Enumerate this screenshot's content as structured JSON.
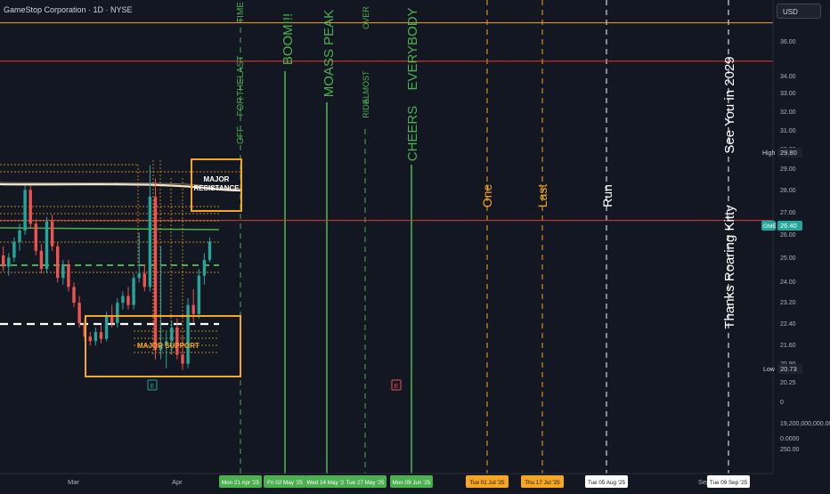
{
  "header": {
    "symbol_title": "GameStop Corporation · 1D · NYSE",
    "currency": "USD"
  },
  "colors": {
    "background": "#131722",
    "up": "#26a69a",
    "down": "#ef5350",
    "orange": "#f5a623",
    "green": "#4caf50",
    "red": "#e53935",
    "white": "#ffffff"
  },
  "price_axis": {
    "ticks": [
      "36.00",
      "34.00",
      "33.00",
      "32.00",
      "31.00",
      "30.00",
      "29.00",
      "28.00",
      "27.00",
      "26.00",
      "25.00",
      "24.00",
      "23.20",
      "22.40",
      "21.60",
      "20.90",
      "20.25",
      "0",
      "19,200,000,000.00",
      "0.0000",
      "250.00"
    ],
    "high_label": "High",
    "high_value": "29.80",
    "ticker_label": "GME",
    "ticker_value": "26.40",
    "low_label": "Low",
    "low_value": "20.73"
  },
  "time_axis": {
    "month_labels": [
      "Mar",
      "Apr",
      "Sep"
    ],
    "date_labels": [
      {
        "text": "Mon 21 Apr '25",
        "style": "green"
      },
      {
        "text": "Fri 02 May '25",
        "style": "green"
      },
      {
        "text": "Wed 14 May '25",
        "style": "green"
      },
      {
        "text": "Tue 27 May '25",
        "style": "green"
      },
      {
        "text": "Mon 09 Jun '25",
        "style": "green"
      },
      {
        "text": "Tue 01 Jul '25",
        "style": "orange"
      },
      {
        "text": "Thu 17 Jul '25",
        "style": "orange"
      },
      {
        "text": "Tue 05 Aug '25",
        "style": "white"
      },
      {
        "text": "Tue 09 Sep '25",
        "style": "white"
      }
    ]
  },
  "annotations": {
    "major_resistance": "MAJOR RESISTANCE",
    "major_support": "MAJOR SUPPORT",
    "vertical_texts": [
      "LAST",
      "TIME",
      "OFF",
      "FOR",
      "THE",
      "BOOM!!!",
      "MOASS PEAK",
      "ALMOST",
      "OVER",
      "RIDE",
      "CHEERS",
      "EVERYBODY",
      "One",
      "Last",
      "Run",
      "See You in 2029",
      "Thanks Roaring Kitty"
    ],
    "earnings_markers": [
      "E",
      "E"
    ]
  },
  "chart_data": {
    "type": "candlestick",
    "title": "GameStop Corporation · 1D · NYSE",
    "y_range": [
      20.25,
      36.5
    ],
    "high": 29.8,
    "low": 20.73,
    "last": 26.4,
    "horizontal_levels": [
      {
        "price": 36.1,
        "color": "#f5a623"
      },
      {
        "price": 34.4,
        "color": "#e53935"
      },
      {
        "price": 27.35,
        "color": "#e53935"
      }
    ],
    "candles": [
      {
        "o": 25.8,
        "h": 26.2,
        "l": 25.1,
        "c": 25.3
      },
      {
        "o": 25.3,
        "h": 25.9,
        "l": 24.9,
        "c": 25.7
      },
      {
        "o": 25.7,
        "h": 26.6,
        "l": 25.5,
        "c": 26.4
      },
      {
        "o": 26.4,
        "h": 27.2,
        "l": 26.0,
        "c": 26.9
      },
      {
        "o": 26.9,
        "h": 28.9,
        "l": 26.7,
        "c": 28.7
      },
      {
        "o": 28.7,
        "h": 28.9,
        "l": 27.0,
        "c": 27.2
      },
      {
        "o": 27.2,
        "h": 27.4,
        "l": 25.8,
        "c": 26.0
      },
      {
        "o": 26.0,
        "h": 26.3,
        "l": 25.0,
        "c": 25.2
      },
      {
        "o": 25.2,
        "h": 27.5,
        "l": 25.0,
        "c": 27.3
      },
      {
        "o": 27.3,
        "h": 27.6,
        "l": 26.0,
        "c": 26.2
      },
      {
        "o": 26.2,
        "h": 26.4,
        "l": 24.6,
        "c": 24.8
      },
      {
        "o": 24.8,
        "h": 25.6,
        "l": 24.5,
        "c": 25.4
      },
      {
        "o": 25.4,
        "h": 25.6,
        "l": 24.2,
        "c": 24.4
      },
      {
        "o": 24.4,
        "h": 24.6,
        "l": 23.5,
        "c": 23.7
      },
      {
        "o": 23.7,
        "h": 24.0,
        "l": 22.6,
        "c": 22.8
      },
      {
        "o": 22.8,
        "h": 23.0,
        "l": 22.0,
        "c": 22.2
      },
      {
        "o": 22.2,
        "h": 22.4,
        "l": 21.8,
        "c": 22.0
      },
      {
        "o": 22.0,
        "h": 22.6,
        "l": 21.8,
        "c": 22.4
      },
      {
        "o": 22.4,
        "h": 22.7,
        "l": 21.9,
        "c": 22.1
      },
      {
        "o": 22.1,
        "h": 23.3,
        "l": 22.0,
        "c": 23.1
      },
      {
        "o": 23.1,
        "h": 23.6,
        "l": 22.6,
        "c": 22.8
      },
      {
        "o": 22.8,
        "h": 23.9,
        "l": 22.6,
        "c": 23.7
      },
      {
        "o": 23.7,
        "h": 24.2,
        "l": 23.4,
        "c": 24.0
      },
      {
        "o": 24.0,
        "h": 24.4,
        "l": 23.4,
        "c": 23.6
      },
      {
        "o": 23.6,
        "h": 25.0,
        "l": 23.4,
        "c": 24.8
      },
      {
        "o": 24.8,
        "h": 26.8,
        "l": 24.6,
        "c": 25.0
      },
      {
        "o": 25.0,
        "h": 25.4,
        "l": 24.2,
        "c": 24.4
      },
      {
        "o": 24.4,
        "h": 29.8,
        "l": 24.2,
        "c": 28.4
      },
      {
        "o": 28.4,
        "h": 29.2,
        "l": 21.2,
        "c": 21.6
      },
      {
        "o": 21.6,
        "h": 26.2,
        "l": 21.2,
        "c": 21.8
      },
      {
        "o": 21.8,
        "h": 22.4,
        "l": 20.8,
        "c": 22.0
      },
      {
        "o": 22.0,
        "h": 22.9,
        "l": 21.4,
        "c": 22.6
      },
      {
        "o": 22.6,
        "h": 23.0,
        "l": 21.2,
        "c": 21.4
      },
      {
        "o": 21.4,
        "h": 22.2,
        "l": 20.73,
        "c": 21.0
      },
      {
        "o": 21.0,
        "h": 23.9,
        "l": 20.8,
        "c": 23.6
      },
      {
        "o": 23.6,
        "h": 24.3,
        "l": 22.8,
        "c": 23.2
      },
      {
        "o": 23.2,
        "h": 25.2,
        "l": 23.0,
        "c": 24.9
      },
      {
        "o": 24.9,
        "h": 25.9,
        "l": 24.5,
        "c": 25.6
      },
      {
        "o": 25.6,
        "h": 26.6,
        "l": 25.5,
        "c": 26.4
      }
    ]
  }
}
